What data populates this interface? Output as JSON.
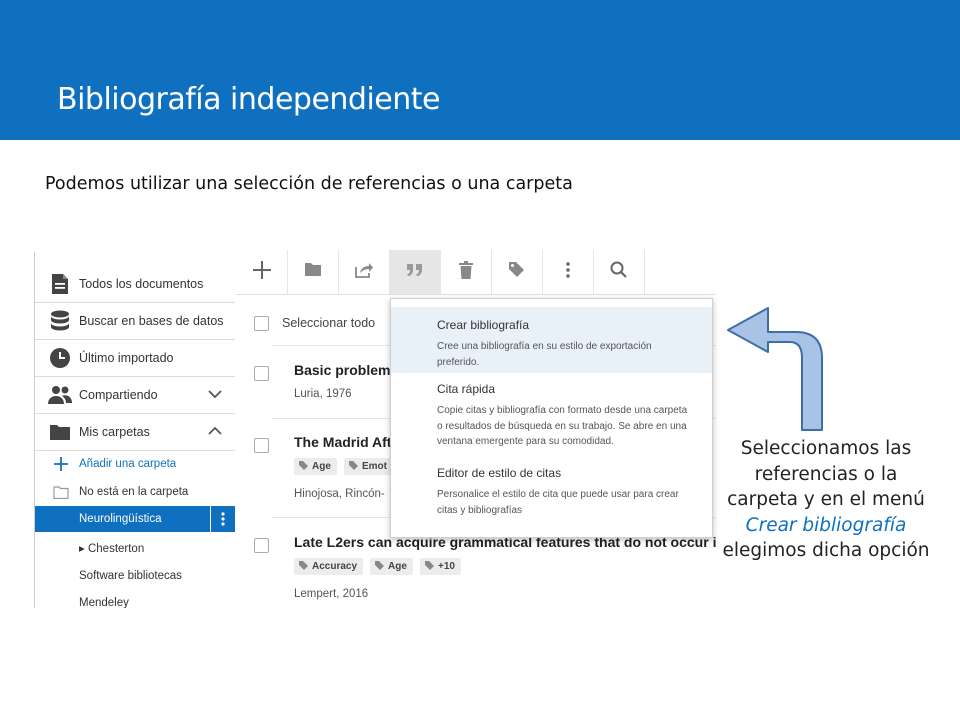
{
  "slide": {
    "title": "Bibliografía independiente",
    "subtitle": "Podemos utilizar una selección de referencias o una carpeta",
    "caption_before": "Seleccionamos las referencias o la carpeta y en el menú ",
    "caption_em": "Crear bibliografía",
    "caption_after": " elegimos dicha opción",
    "header_color": "#0f70c0"
  },
  "sidebar": {
    "items": [
      {
        "label": "Todos los documentos",
        "icon": "document-icon"
      },
      {
        "label": "Buscar en bases de datos",
        "icon": "database-icon"
      },
      {
        "label": "Último importado",
        "icon": "clock-icon"
      },
      {
        "label": "Compartiendo",
        "icon": "people-icon",
        "chevron": "chevron-down-icon"
      },
      {
        "label": "Mis carpetas",
        "icon": "folder-icon",
        "chevron": "chevron-up-icon"
      }
    ],
    "folders": [
      {
        "label": "Añadir una carpeta"
      },
      {
        "label": "No está en la carpeta"
      },
      {
        "label": "Neurolingüística",
        "selected": true
      },
      {
        "label": "▸ Chesterton"
      },
      {
        "label": "Software bibliotecas"
      },
      {
        "label": "Mendeley"
      }
    ]
  },
  "toolbar": {
    "buttons": [
      "add-icon",
      "folder-icon",
      "share-icon",
      "quote-icon",
      "trash-icon",
      "tag-icon",
      "more-icon",
      "search-icon"
    ],
    "active": "quote-icon"
  },
  "list": {
    "select_all": "Seleccionar todo",
    "documents": [
      {
        "title": "Basic problem",
        "meta": "Luria, 1976",
        "tags": []
      },
      {
        "title": "The Madrid Aft",
        "meta": "Hinojosa, Rincón-",
        "tags": [
          "Age",
          "Emot"
        ]
      },
      {
        "title": "Late L2ers can acquire grammatical features that do not occur i",
        "meta": "Lempert, 2016",
        "tags": [
          "Accuracy",
          "Age",
          "+10"
        ]
      }
    ]
  },
  "dropdown": {
    "items": [
      {
        "title": "Crear bibliografía",
        "desc": "Cree una bibliografía en su estilo de exportación preferido.",
        "highlighted": true
      },
      {
        "title": "Cita rápida",
        "desc": "Copie citas y bibliografía con formato desde una carpeta o resultados de búsqueda en su trabajo. Se abre en una ventana emergente para su comodidad."
      },
      {
        "title": "Editor de estilo de citas",
        "desc": "Personalice el estilo de cita que puede usar para crear citas y bibliografías"
      }
    ]
  }
}
